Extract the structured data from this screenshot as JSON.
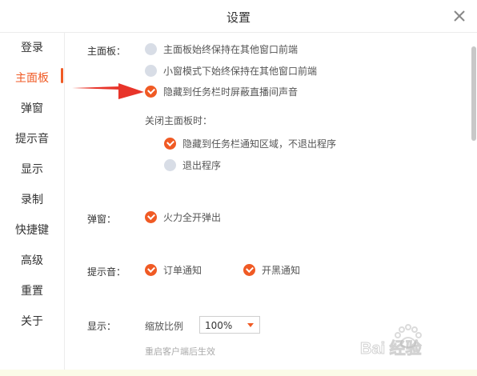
{
  "window": {
    "title": "设置"
  },
  "sidebar": {
    "items": [
      {
        "label": "登录"
      },
      {
        "label": "主面板"
      },
      {
        "label": "弹窗"
      },
      {
        "label": "提示音"
      },
      {
        "label": "显示"
      },
      {
        "label": "录制"
      },
      {
        "label": "快捷键"
      },
      {
        "label": "高级"
      },
      {
        "label": "重置"
      },
      {
        "label": "关于"
      }
    ],
    "active_index": 1
  },
  "main_panel": {
    "label": "主面板：",
    "options": [
      {
        "label": "主面板始终保持在其他窗口前端",
        "checked": false
      },
      {
        "label": "小窗模式下始终保持在其他窗口前端",
        "checked": false
      },
      {
        "label": "隐藏到任务栏时屏蔽直播间声音",
        "checked": true
      }
    ],
    "close_label": "关闭主面板时：",
    "close_options": [
      {
        "label": "隐藏到任务栏通知区域，不退出程序",
        "checked": true
      },
      {
        "label": "退出程序",
        "checked": false
      }
    ]
  },
  "popup": {
    "label": "弹窗：",
    "options": [
      {
        "label": "火力全开弹出",
        "checked": true
      }
    ]
  },
  "sound": {
    "label": "提示音：",
    "options": [
      {
        "label": "订单通知",
        "checked": true
      },
      {
        "label": "开黑通知",
        "checked": true
      }
    ]
  },
  "display": {
    "label": "显示：",
    "zoom_label": "缩放比例",
    "zoom_value": "100%",
    "hint": "重启客户端后生效"
  },
  "watermark": {
    "text": "Bai 经验"
  },
  "colors": {
    "accent": "#f05a24",
    "unchecked": "#d8dde6",
    "annotation_arrow": "#e8342a"
  }
}
